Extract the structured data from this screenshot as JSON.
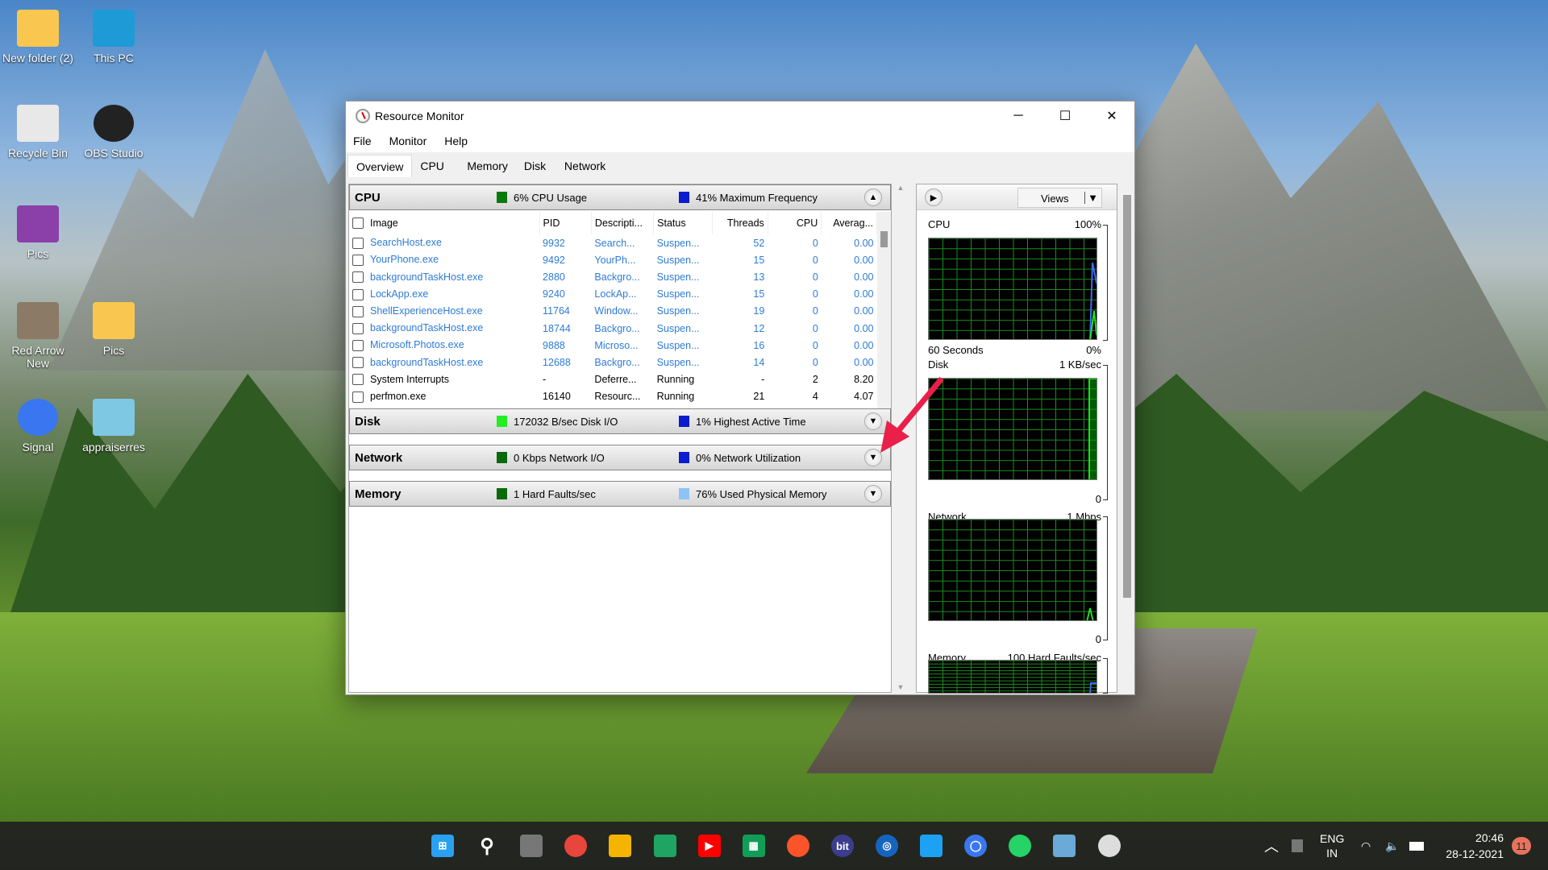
{
  "desktop": {
    "icons": [
      {
        "label": "New folder (2)",
        "icon": "folder-icon",
        "color": "#f9c74f"
      },
      {
        "label": "This PC",
        "icon": "monitor-icon",
        "color": "#1e9bd7"
      },
      {
        "label": "Recycle Bin",
        "icon": "recycle-bin-icon",
        "color": "#e8e8e8"
      },
      {
        "label": "OBS Studio",
        "icon": "obs-icon",
        "color": "#222222"
      },
      {
        "label": "Pics",
        "icon": "winrar-archive-icon",
        "color": "#8b3fa8"
      },
      {
        "label": "Red Arrow New",
        "icon": "image-file-icon",
        "color": "#8a7a66"
      },
      {
        "label": "Pics",
        "icon": "folder-icon",
        "color": "#f9c74f"
      },
      {
        "label": "Signal",
        "icon": "signal-icon",
        "color": "#3a76f0"
      },
      {
        "label": "appraiserres",
        "icon": "notepad-icon",
        "color": "#7ec8e3"
      }
    ]
  },
  "window": {
    "title": "Resource Monitor",
    "minimize": "─",
    "maximize": "☐",
    "close": "✕",
    "menu": [
      "File",
      "Monitor",
      "Help"
    ],
    "tabs": [
      "Overview",
      "CPU",
      "Memory",
      "Disk",
      "Network"
    ],
    "active_tab": "Overview"
  },
  "cpu": {
    "name": "CPU",
    "metric1": "6% CPU Usage",
    "metric1_color": "#0a7a0a",
    "metric2": "41% Maximum Frequency",
    "metric2_color": "#0a1ccf",
    "expanded": true,
    "columns": [
      "Image",
      "PID",
      "Descripti...",
      "Status",
      "Threads",
      "CPU",
      "Averag..."
    ],
    "rows": [
      [
        "SearchHost.exe",
        "9932",
        "Search...",
        "Suspen...",
        "52",
        "0",
        "0.00"
      ],
      [
        "YourPhone.exe",
        "9492",
        "YourPh...",
        "Suspen...",
        "15",
        "0",
        "0.00"
      ],
      [
        "backgroundTaskHost.exe",
        "2880",
        "Backgro...",
        "Suspen...",
        "13",
        "0",
        "0.00"
      ],
      [
        "LockApp.exe",
        "9240",
        "LockAp...",
        "Suspen...",
        "15",
        "0",
        "0.00"
      ],
      [
        "ShellExperienceHost.exe",
        "11764",
        "Window...",
        "Suspen...",
        "19",
        "0",
        "0.00"
      ],
      [
        "backgroundTaskHost.exe",
        "18744",
        "Backgro...",
        "Suspen...",
        "12",
        "0",
        "0.00"
      ],
      [
        "Microsoft.Photos.exe",
        "9888",
        "Microso...",
        "Suspen...",
        "16",
        "0",
        "0.00"
      ],
      [
        "backgroundTaskHost.exe",
        "12688",
        "Backgro...",
        "Suspen...",
        "14",
        "0",
        "0.00"
      ],
      [
        "System Interrupts",
        "-",
        "Deferre...",
        "Running",
        "-",
        "2",
        "8.20"
      ],
      [
        "perfmon.exe",
        "16140",
        "Resourc...",
        "Running",
        "21",
        "4",
        "4.07"
      ]
    ]
  },
  "disk": {
    "name": "Disk",
    "metric1": "172032 B/sec Disk I/O",
    "metric1_color": "#22ee22",
    "metric2": "1% Highest Active Time",
    "metric2_color": "#0a1ccf"
  },
  "network": {
    "name": "Network",
    "metric1": "0 Kbps Network I/O",
    "metric1_color": "#0a6a0a",
    "metric2": "0% Network Utilization",
    "metric2_color": "#0a1ccf"
  },
  "memory": {
    "name": "Memory",
    "metric1": "1 Hard Faults/sec",
    "metric1_color": "#0a6a0a",
    "metric2": "76% Used Physical Memory",
    "metric2_color": "#8fc3f5"
  },
  "graphs": {
    "views_label": "Views",
    "cpu": {
      "label": "CPU",
      "max": "100%",
      "min": "0%",
      "time": "60 Seconds"
    },
    "disk": {
      "label": "Disk",
      "max": "1 KB/sec",
      "min": "0"
    },
    "network": {
      "label": "Network",
      "max": "1 Mbps",
      "min": "0"
    },
    "memory": {
      "label": "Memory",
      "max": "100 Hard Faults/sec"
    }
  },
  "taskbar": {
    "apps": [
      {
        "name": "start",
        "icon": "windows-icon",
        "color": "#2aa0f0",
        "glyph": "⊞"
      },
      {
        "name": "search",
        "icon": "search-icon",
        "color": "transparent",
        "glyph": "⚲"
      },
      {
        "name": "task-view",
        "icon": "task-view-icon",
        "color": "#777",
        "glyph": ""
      },
      {
        "name": "chrome",
        "icon": "chrome-icon",
        "color": "#e8453c",
        "glyph": ""
      },
      {
        "name": "file-explorer",
        "icon": "folder-icon",
        "color": "#f4b400",
        "glyph": ""
      },
      {
        "name": "google-drive",
        "icon": "google-drive-icon",
        "color": "#1fa463",
        "glyph": ""
      },
      {
        "name": "youtube",
        "icon": "youtube-icon",
        "color": "#ff0000",
        "glyph": "▶"
      },
      {
        "name": "google-sheets",
        "icon": "sheets-icon",
        "color": "#0f9d58",
        "glyph": "▦"
      },
      {
        "name": "brave",
        "icon": "brave-icon",
        "color": "#fb542b",
        "glyph": ""
      },
      {
        "name": "bit",
        "icon": "bit-icon",
        "color": "#3d3d8f",
        "glyph": "bit"
      },
      {
        "name": "browser",
        "icon": "blue-ring-icon",
        "color": "#1565c0",
        "glyph": "◎"
      },
      {
        "name": "twitter",
        "icon": "twitter-icon",
        "color": "#1da1f2",
        "glyph": ""
      },
      {
        "name": "signal",
        "icon": "signal-icon",
        "color": "#3a76f0",
        "glyph": "◯"
      },
      {
        "name": "whatsapp",
        "icon": "whatsapp-icon",
        "color": "#25d366",
        "glyph": ""
      },
      {
        "name": "performance-monitor",
        "icon": "chart-icon",
        "color": "#6aa9d8",
        "glyph": ""
      },
      {
        "name": "resource-monitor",
        "icon": "resource-monitor-icon",
        "color": "#dddddd",
        "glyph": ""
      }
    ],
    "lang1": "ENG",
    "lang2": "IN",
    "time": "20:46",
    "date": "28-12-2021",
    "notifications": "11"
  }
}
